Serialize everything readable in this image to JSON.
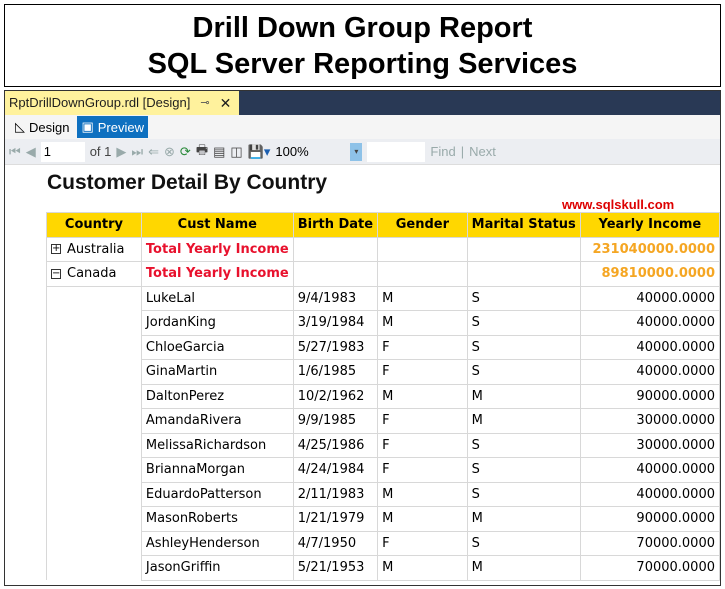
{
  "banner": {
    "line1": "Drill Down Group Report",
    "line2": "SQL Server Reporting Services"
  },
  "tab": {
    "label": "RptDrillDownGroup.rdl [Design]",
    "pin": "⊸",
    "close": "✕"
  },
  "modes": {
    "design": "Design",
    "preview": "Preview"
  },
  "nav": {
    "page": "1",
    "of": "of 1",
    "zoom": "100%",
    "find": "Find",
    "next": "Next"
  },
  "report": {
    "title": "Customer Detail By Country",
    "site": "www.sqlskull.com",
    "headers": [
      "Country",
      "Cust Name",
      "Birth Date",
      "Gender",
      "Marital Status",
      "Yearly Income"
    ],
    "groups": [
      {
        "country": "Australia",
        "toggle": "+",
        "label": "Total Yearly Income",
        "total": "231040000.0000"
      },
      {
        "country": "Canada",
        "toggle": "−",
        "label": "Total Yearly Income",
        "total": "89810000.0000"
      }
    ],
    "rows": [
      [
        "LukeLal",
        "9/4/1983",
        "M",
        "S",
        "40000.0000"
      ],
      [
        "JordanKing",
        "3/19/1984",
        "M",
        "S",
        "40000.0000"
      ],
      [
        "ChloeGarcia",
        "5/27/1983",
        "F",
        "S",
        "40000.0000"
      ],
      [
        "GinaMartin",
        "1/6/1985",
        "F",
        "S",
        "40000.0000"
      ],
      [
        "DaltonPerez",
        "10/2/1962",
        "M",
        "M",
        "90000.0000"
      ],
      [
        "AmandaRivera",
        "9/9/1985",
        "F",
        "M",
        "30000.0000"
      ],
      [
        "MelissaRichardson",
        "4/25/1986",
        "F",
        "S",
        "30000.0000"
      ],
      [
        "BriannaMorgan",
        "4/24/1984",
        "F",
        "S",
        "40000.0000"
      ],
      [
        "EduardoPatterson",
        "2/11/1983",
        "M",
        "S",
        "40000.0000"
      ],
      [
        "MasonRoberts",
        "1/21/1979",
        "M",
        "M",
        "90000.0000"
      ],
      [
        "AshleyHenderson",
        "4/7/1950",
        "F",
        "S",
        "70000.0000"
      ],
      [
        "JasonGriffin",
        "5/21/1953",
        "M",
        "M",
        "70000.0000"
      ]
    ]
  }
}
